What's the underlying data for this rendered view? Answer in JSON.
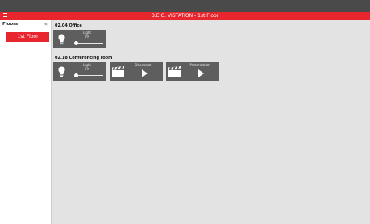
{
  "header": {
    "title": "B.E.G. VISTATION - 1st Floor",
    "accent_color": "#e8262d",
    "menu_icon": "hamburger-menu-icon"
  },
  "sidebar": {
    "title": "Floors",
    "collapse_icon": "double-chevron-left-icon",
    "items": [
      {
        "label": "1st Floor",
        "selected": true
      }
    ]
  },
  "rooms": [
    {
      "title": "02.04 Office",
      "widgets": [
        {
          "type": "light",
          "label": "Light",
          "value": "0%",
          "level": 0,
          "icon": "lightbulb-icon"
        }
      ]
    },
    {
      "title": "02.18 Conferencing room",
      "widgets": [
        {
          "type": "light",
          "label": "Light",
          "value": "0%",
          "level": 0,
          "icon": "lightbulb-icon"
        },
        {
          "type": "scene",
          "label": "Discussion",
          "icon": "clapperboard-icon",
          "action_icon": "play-icon"
        },
        {
          "type": "scene",
          "label": "Presentation",
          "icon": "clapperboard-icon",
          "action_icon": "play-icon"
        }
      ]
    }
  ]
}
